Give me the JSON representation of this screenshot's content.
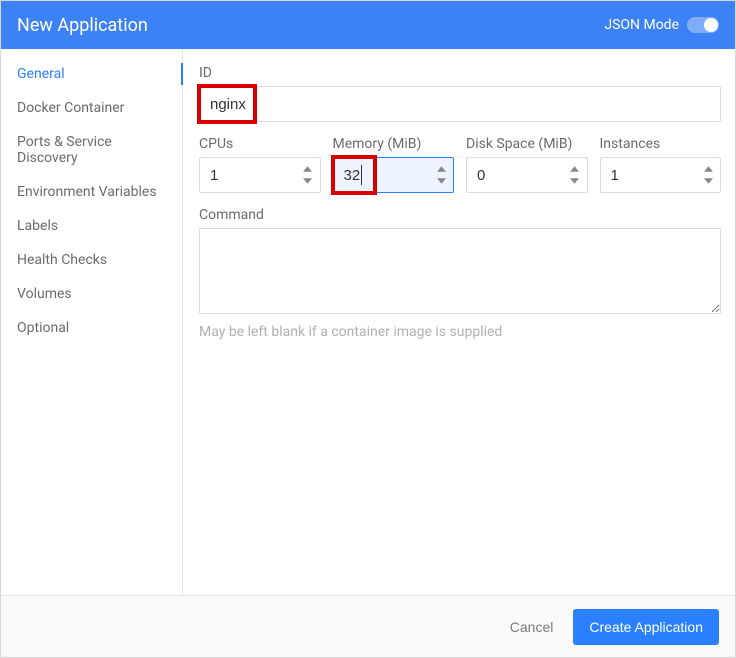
{
  "header": {
    "title": "New Application",
    "json_mode_label": "JSON Mode"
  },
  "sidebar": {
    "items": [
      {
        "label": "General",
        "active": true
      },
      {
        "label": "Docker Container",
        "active": false
      },
      {
        "label": "Ports & Service Discovery",
        "active": false
      },
      {
        "label": "Environment Variables",
        "active": false
      },
      {
        "label": "Labels",
        "active": false
      },
      {
        "label": "Health Checks",
        "active": false
      },
      {
        "label": "Volumes",
        "active": false
      },
      {
        "label": "Optional",
        "active": false
      }
    ]
  },
  "form": {
    "id_label": "ID",
    "id_value": "nginx",
    "cpus_label": "CPUs",
    "cpus_value": "1",
    "memory_label": "Memory (MiB)",
    "memory_value": "32",
    "disk_label": "Disk Space (MiB)",
    "disk_value": "0",
    "instances_label": "Instances",
    "instances_value": "1",
    "command_label": "Command",
    "command_value": "",
    "command_help": "May be left blank if a container image is supplied"
  },
  "footer": {
    "cancel_label": "Cancel",
    "create_label": "Create Application"
  },
  "highlights": {
    "id": true,
    "memory": true
  },
  "colors": {
    "primary": "#2B80FF",
    "header_bg": "#3D81F6",
    "highlight": "#D90000"
  }
}
